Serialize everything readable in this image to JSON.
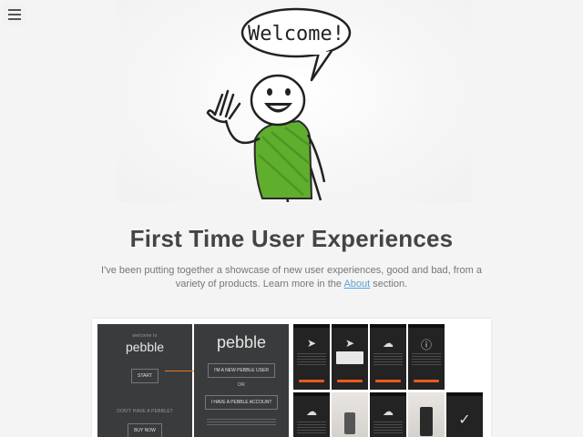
{
  "nav": {
    "menu_icon": "hamburger-menu-icon"
  },
  "hero": {
    "speech_text": "Welcome!"
  },
  "page": {
    "title": "First Time User Experiences",
    "intro_before": "I've been putting together a showcase of new user experiences, good and bad, from a variety of products. Learn more in the",
    "intro_link": "About",
    "intro_after": "section."
  },
  "preview": {
    "screen1": {
      "welcome_to": "welcome to",
      "brand": "pebble",
      "start": "START",
      "no_pebble": "DON'T HAVE A PEBBLE?",
      "buy_now": "BUY NOW"
    },
    "screen2": {
      "brand": "pebble",
      "new_user": "I'M A NEW PEBBLE USER",
      "or": "OR",
      "have_account": "I HAVE A PEBBLE ACCOUNT"
    }
  }
}
